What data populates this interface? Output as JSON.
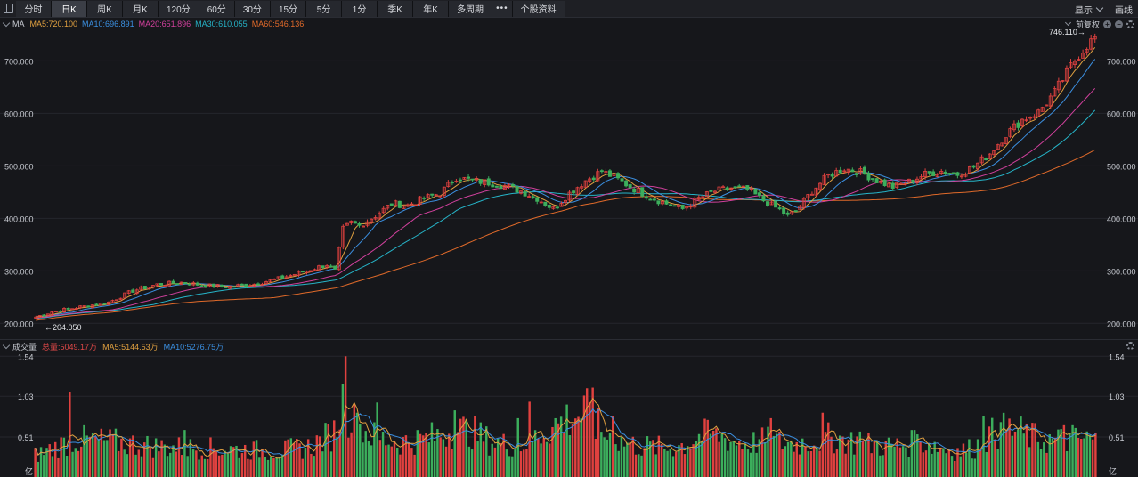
{
  "toolbar": {
    "tabs": [
      {
        "label": "分时",
        "active": false
      },
      {
        "label": "日K",
        "active": true
      },
      {
        "label": "周K",
        "active": false
      },
      {
        "label": "月K",
        "active": false
      },
      {
        "label": "120分",
        "active": false
      },
      {
        "label": "60分",
        "active": false
      },
      {
        "label": "30分",
        "active": false
      },
      {
        "label": "15分",
        "active": false
      },
      {
        "label": "5分",
        "active": false
      },
      {
        "label": "1分",
        "active": false
      },
      {
        "label": "季K",
        "active": false
      },
      {
        "label": "年K",
        "active": false
      },
      {
        "label": "多周期",
        "active": false
      },
      {
        "label": "•••",
        "active": false
      },
      {
        "label": "个股资料",
        "active": false
      }
    ],
    "display_label": "显示",
    "draw_label": "画线"
  },
  "ma_legend": {
    "label": "MA",
    "items": [
      {
        "text": "MA5:720.100",
        "color": "#e0a040"
      },
      {
        "text": "MA10:696.891",
        "color": "#3b8fe0"
      },
      {
        "text": "MA20:651.896",
        "color": "#d0409c"
      },
      {
        "text": "MA30:610.055",
        "color": "#26b4c8"
      },
      {
        "text": "MA60:546.136",
        "color": "#e06a2a"
      }
    ],
    "adjust_label": "前复权"
  },
  "volume_legend": {
    "label": "成交量",
    "items": [
      {
        "text": "总量:5049.17万",
        "color": "#e04848"
      },
      {
        "text": "MA5:5144.53万",
        "color": "#e0a040"
      },
      {
        "text": "MA10:5276.75万",
        "color": "#3b8fe0"
      }
    ]
  },
  "colors": {
    "up": "#e0413f",
    "down": "#3cae5c",
    "background": "#16171b",
    "grid": "#25272d"
  },
  "chart_data": [
    {
      "type": "candlestick",
      "y_axis_labels": [
        "700.000",
        "600.000",
        "500.000",
        "400.000",
        "300.000",
        "200.000"
      ],
      "y_ticks": [
        700,
        600,
        500,
        400,
        300,
        200
      ],
      "ylim": [
        170,
        760
      ],
      "high_annotation": {
        "text": "746.110→",
        "value": 746.11
      },
      "low_annotation": {
        "text": "←204.050",
        "value": 204.05
      },
      "close_anchors": [
        [
          0,
          212
        ],
        [
          4,
          222
        ],
        [
          10,
          230
        ],
        [
          18,
          240
        ],
        [
          24,
          262
        ],
        [
          30,
          274
        ],
        [
          36,
          278
        ],
        [
          42,
          272
        ],
        [
          48,
          270
        ],
        [
          54,
          275
        ],
        [
          60,
          285
        ],
        [
          66,
          298
        ],
        [
          72,
          312
        ],
        [
          74,
          300
        ],
        [
          76,
          380
        ],
        [
          78,
          392
        ],
        [
          80,
          386
        ],
        [
          84,
          405
        ],
        [
          88,
          428
        ],
        [
          92,
          425
        ],
        [
          96,
          438
        ],
        [
          100,
          448
        ],
        [
          104,
          478
        ],
        [
          108,
          472
        ],
        [
          112,
          468
        ],
        [
          116,
          462
        ],
        [
          120,
          452
        ],
        [
          124,
          438
        ],
        [
          128,
          418
        ],
        [
          132,
          448
        ],
        [
          136,
          472
        ],
        [
          140,
          490
        ],
        [
          144,
          474
        ],
        [
          148,
          456
        ],
        [
          152,
          440
        ],
        [
          156,
          428
        ],
        [
          160,
          418
        ],
        [
          164,
          438
        ],
        [
          168,
          452
        ],
        [
          172,
          458
        ],
        [
          176,
          455
        ],
        [
          180,
          434
        ],
        [
          184,
          416
        ],
        [
          186,
          404
        ],
        [
          188,
          414
        ],
        [
          192,
          452
        ],
        [
          196,
          482
        ],
        [
          200,
          495
        ],
        [
          204,
          488
        ],
        [
          208,
          472
        ],
        [
          212,
          460
        ],
        [
          216,
          470
        ],
        [
          220,
          484
        ],
        [
          224,
          490
        ],
        [
          228,
          484
        ],
        [
          232,
          498
        ],
        [
          236,
          524
        ],
        [
          240,
          560
        ],
        [
          244,
          588
        ],
        [
          248,
          602
        ],
        [
          252,
          640
        ],
        [
          256,
          690
        ],
        [
          258,
          712
        ],
        [
          260,
          730
        ],
        [
          262,
          744
        ]
      ],
      "ma5": 720.1,
      "ma10": 696.891,
      "ma20": 651.896,
      "ma30": 610.055,
      "ma60": 546.136
    },
    {
      "type": "bar",
      "y_axis_labels": [
        "1.54",
        "1.03",
        "0.51"
      ],
      "y_ticks": [
        1.54,
        1.03,
        0.51
      ],
      "unit": "亿",
      "ylim": [
        0,
        1.6
      ],
      "volume_anchors": [
        [
          0,
          0.3
        ],
        [
          10,
          0.52
        ],
        [
          20,
          0.48
        ],
        [
          30,
          0.42
        ],
        [
          40,
          0.4
        ],
        [
          50,
          0.38
        ],
        [
          60,
          0.36
        ],
        [
          68,
          0.42
        ],
        [
          72,
          0.55
        ],
        [
          74,
          0.62
        ],
        [
          76,
          1.05
        ],
        [
          78,
          0.8
        ],
        [
          80,
          0.7
        ],
        [
          84,
          0.55
        ],
        [
          90,
          0.48
        ],
        [
          96,
          0.52
        ],
        [
          100,
          0.58
        ],
        [
          104,
          0.66
        ],
        [
          108,
          0.62
        ],
        [
          112,
          0.5
        ],
        [
          116,
          0.45
        ],
        [
          120,
          0.44
        ],
        [
          124,
          0.56
        ],
        [
          128,
          0.7
        ],
        [
          132,
          0.82
        ],
        [
          136,
          0.9
        ],
        [
          140,
          0.62
        ],
        [
          144,
          0.5
        ],
        [
          148,
          0.44
        ],
        [
          152,
          0.42
        ],
        [
          156,
          0.4
        ],
        [
          160,
          0.44
        ],
        [
          164,
          0.56
        ],
        [
          168,
          0.6
        ],
        [
          172,
          0.5
        ],
        [
          176,
          0.46
        ],
        [
          180,
          0.5
        ],
        [
          184,
          0.48
        ],
        [
          188,
          0.46
        ],
        [
          192,
          0.5
        ],
        [
          196,
          0.54
        ],
        [
          200,
          0.52
        ],
        [
          204,
          0.46
        ],
        [
          208,
          0.44
        ],
        [
          212,
          0.42
        ],
        [
          216,
          0.46
        ],
        [
          220,
          0.48
        ],
        [
          224,
          0.4
        ],
        [
          228,
          0.36
        ],
        [
          232,
          0.4
        ],
        [
          236,
          0.58
        ],
        [
          240,
          0.66
        ],
        [
          244,
          0.6
        ],
        [
          248,
          0.52
        ],
        [
          252,
          0.5
        ],
        [
          256,
          0.52
        ],
        [
          260,
          0.52
        ],
        [
          262,
          0.5
        ]
      ],
      "spikes": {
        "12": 1.08,
        "52": 0.6,
        "108": 1.54,
        "112": 0.82,
        "119": 0.95,
        "146": 0.85,
        "168": 0.75,
        "172": 0.96,
        "194": 1.14,
        "201": 0.78,
        "237": 0.62,
        "256": 0.75,
        "274": 0.82,
        "287": 0.58,
        "306": 0.6,
        "330": 0.78,
        "336": 0.7,
        "358": 0.66,
        "361": 0.66
      }
    }
  ]
}
